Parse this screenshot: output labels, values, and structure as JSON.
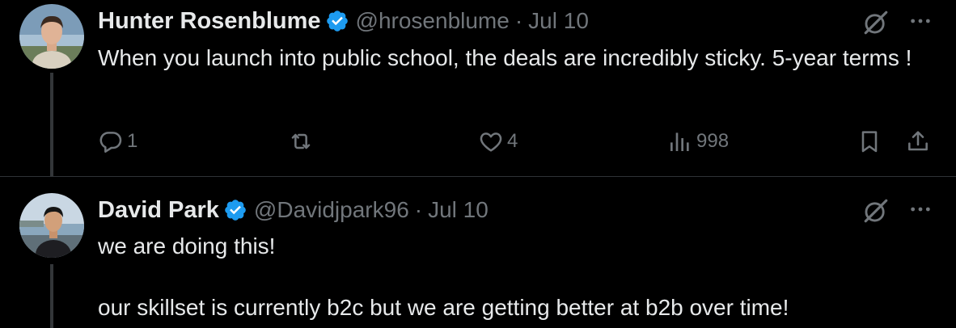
{
  "tweets": [
    {
      "author": "Hunter Rosenblume",
      "handle": "@hrosenblume",
      "date": "Jul 10",
      "text": "When you launch into public school, the deals are incredibly sticky. 5-year terms !",
      "replies": "1",
      "reposts": "",
      "likes": "4",
      "views": "998"
    },
    {
      "author": "David Park",
      "handle": "@Davidjpark96",
      "date": "Jul 10",
      "text": "we are doing this!\n\nour skillset is currently b2c but we are getting better at b2b over time!"
    }
  ],
  "separator": "·",
  "colors": {
    "background": "#000000",
    "text": "#e7e9ea",
    "muted": "#71767b",
    "verified": "#1d9bf0",
    "thread_line": "#333639"
  },
  "icons": [
    "verified-badge-icon",
    "grok-icon",
    "more-icon",
    "reply-icon",
    "repost-icon",
    "like-icon",
    "views-icon",
    "bookmark-icon",
    "share-icon"
  ]
}
